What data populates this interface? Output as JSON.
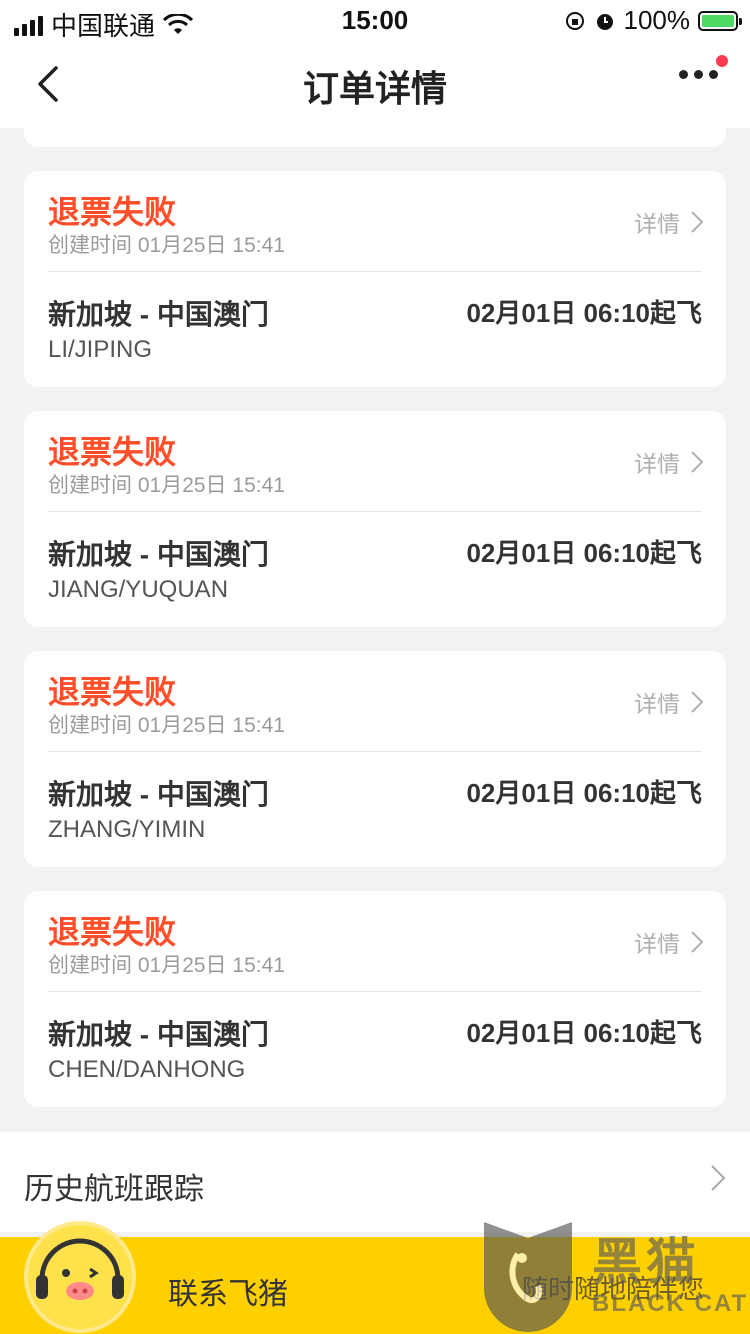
{
  "status_bar": {
    "carrier": "中国联通",
    "time": "15:00",
    "battery": "100%",
    "battery_level": 1.0
  },
  "nav": {
    "title": "订单详情"
  },
  "orders": [
    {
      "status": "退票失败",
      "created": "创建时间 01月25日 15:41",
      "detail_label": "详情",
      "route": "新加坡 - 中国澳门",
      "departure": "02月01日 06:10起飞",
      "passenger": "LI/JIPING"
    },
    {
      "status": "退票失败",
      "created": "创建时间 01月25日 15:41",
      "detail_label": "详情",
      "route": "新加坡 - 中国澳门",
      "departure": "02月01日 06:10起飞",
      "passenger": "JIANG/YUQUAN"
    },
    {
      "status": "退票失败",
      "created": "创建时间 01月25日 15:41",
      "detail_label": "详情",
      "route": "新加坡 - 中国澳门",
      "departure": "02月01日 06:10起飞",
      "passenger": "ZHANG/YIMIN"
    },
    {
      "status": "退票失败",
      "created": "创建时间 01月25日 15:41",
      "detail_label": "详情",
      "route": "新加坡 - 中国澳门",
      "departure": "02月01日 06:10起飞",
      "passenger": "CHEN/DANHONG"
    }
  ],
  "history": {
    "label": "历史航班跟踪"
  },
  "contact": {
    "label": "联系飞猪",
    "sub": "随时随地陪伴您"
  },
  "watermark": {
    "cn": "黑猫",
    "en": "BLACK CAT"
  },
  "colors": {
    "status_fail": "#ff4f2a",
    "contact_bar": "#ffd000",
    "badge": "#ff3b50"
  }
}
